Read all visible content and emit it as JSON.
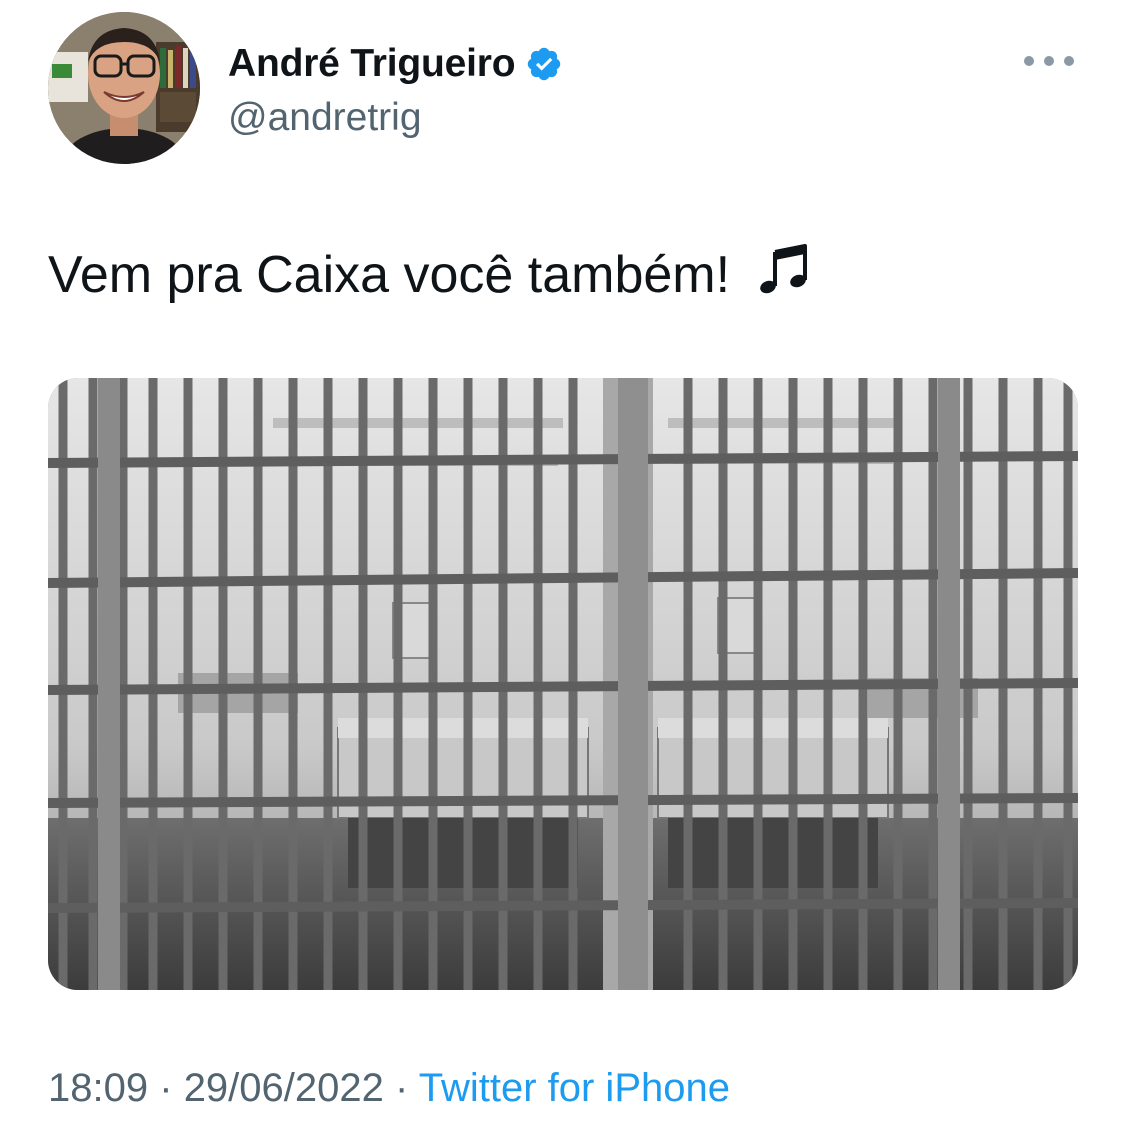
{
  "author": {
    "display_name": "André Trigueiro",
    "handle": "@andretrig",
    "verified_color": "#1d9bf0"
  },
  "tweet": {
    "text": "Vem pra Caixa você também!",
    "emoji": "music-notes-icon"
  },
  "meta": {
    "time": "18:09",
    "separator": "·",
    "date": "29/06/2022",
    "source": "Twitter for iPhone"
  },
  "colors": {
    "text": "#0f1419",
    "secondary": "#536471",
    "link": "#1d9bf0"
  }
}
